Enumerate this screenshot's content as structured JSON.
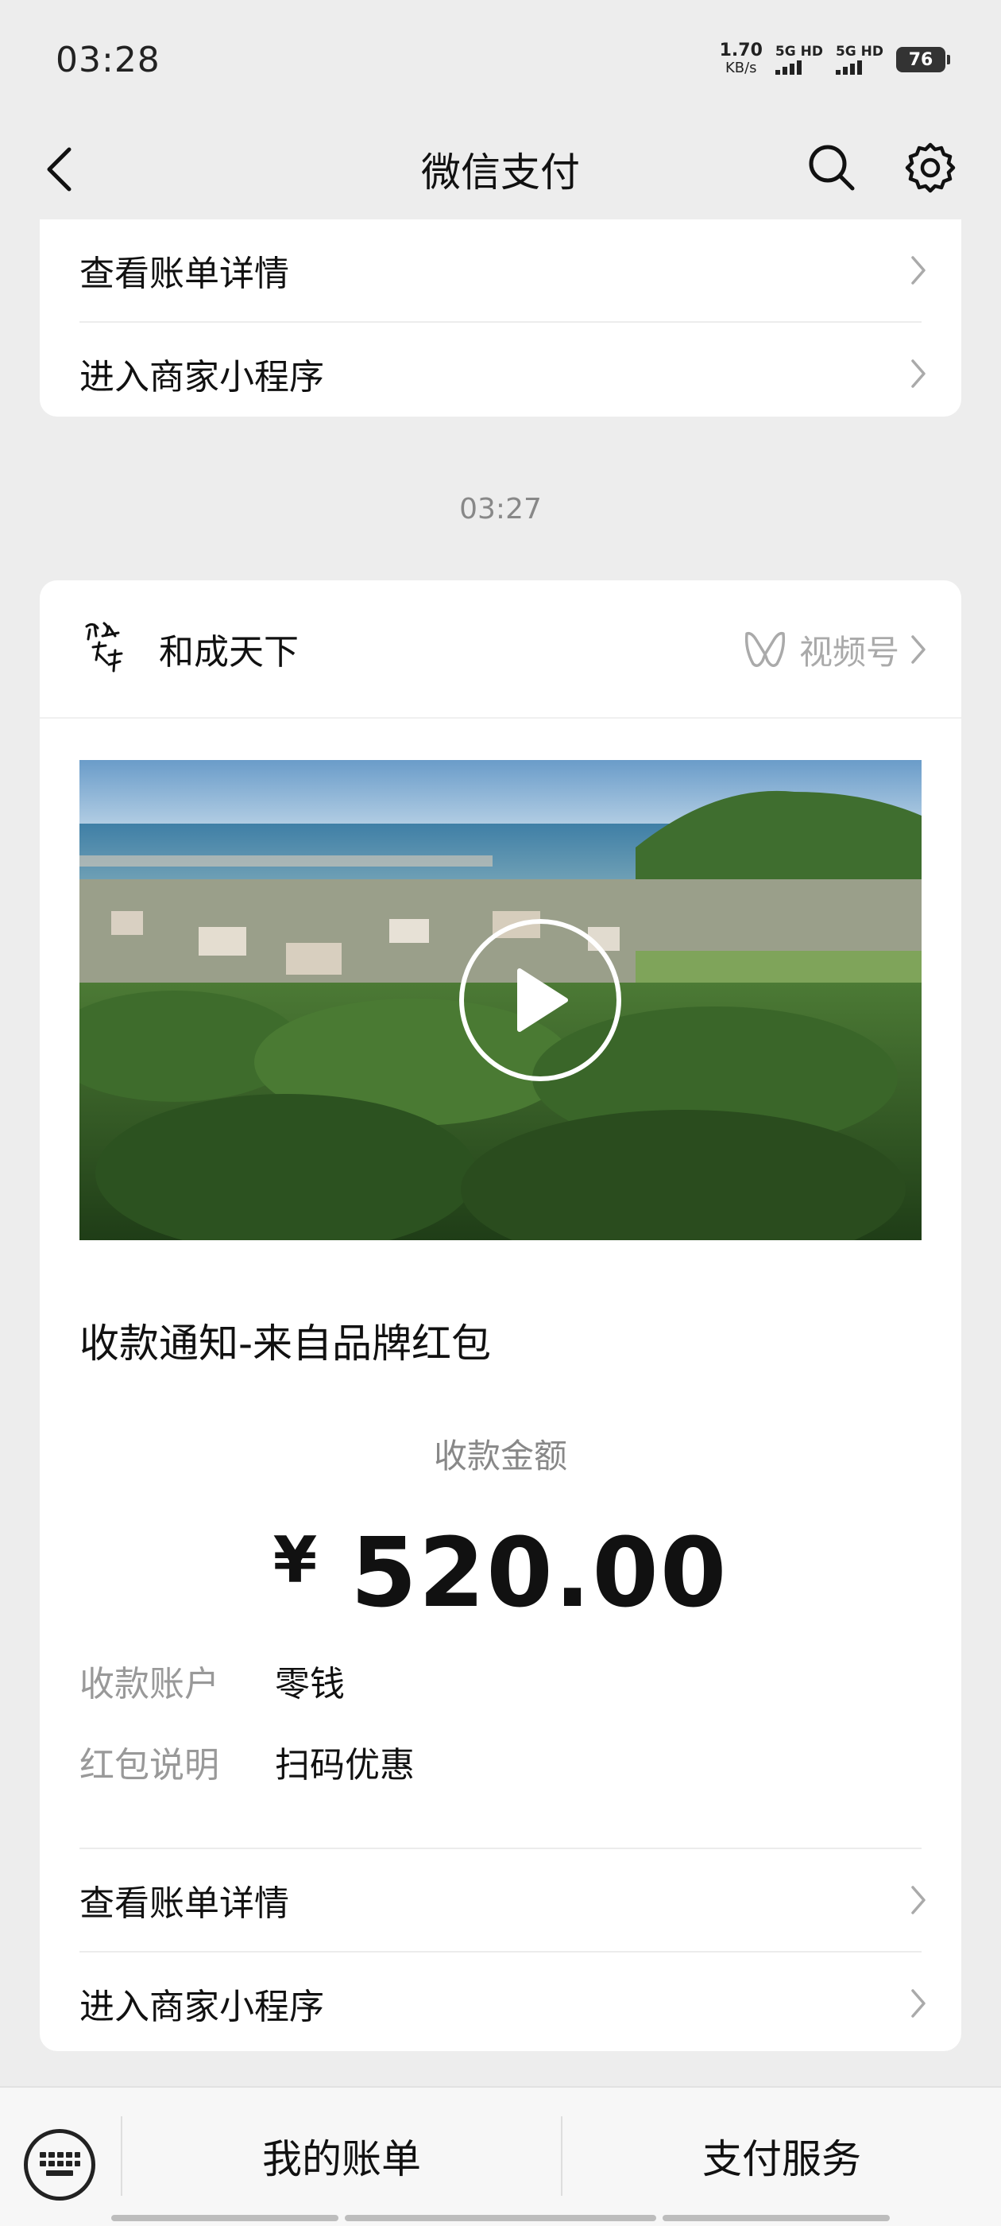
{
  "status": {
    "time": "03:28",
    "net_speed": "1.70",
    "net_unit": "KB/s",
    "sim1": "5G HD",
    "sim2": "5G HD",
    "battery": "76"
  },
  "header": {
    "title": "微信支付",
    "back_icon": "chevron-left-icon",
    "search_icon": "search-icon",
    "settings_icon": "gear-icon"
  },
  "top_card": {
    "links": [
      "查看账单详情",
      "进入商家小程序"
    ]
  },
  "message_time": "03:27",
  "message": {
    "source_name": "和成天下",
    "channel_label": "视频号",
    "title": "收款通知-来自品牌红包",
    "amount_label": "收款金额",
    "currency": "¥",
    "amount": "520.00",
    "fields": [
      {
        "key": "收款账户",
        "value": "零钱"
      },
      {
        "key": "红包说明",
        "value": "扫码优惠"
      }
    ],
    "links": [
      "查看账单详情",
      "进入商家小程序"
    ]
  },
  "bottom": {
    "keyboard_icon": "keyboard-icon",
    "my_bills": "我的账单",
    "pay_service": "支付服务"
  },
  "colors": {
    "background": "#ededed",
    "card": "#ffffff",
    "muted_text": "#888888"
  }
}
